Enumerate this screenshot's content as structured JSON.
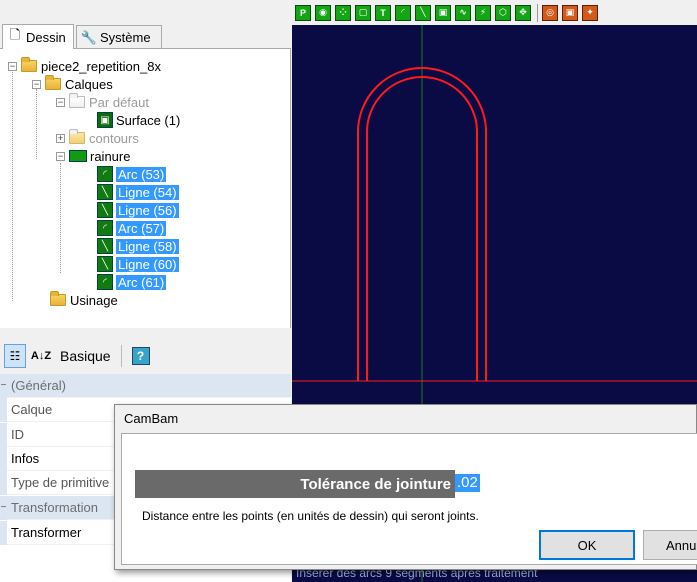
{
  "tabs": [
    {
      "label": "Dessin",
      "icon": "document-icon"
    },
    {
      "label": "Système",
      "icon": "wrench-icon"
    }
  ],
  "tree": {
    "root": "piece2_repetition_8x",
    "calques": "Calques",
    "par_defaut": "Par défaut",
    "surface": "Surface (1)",
    "contours": "contours",
    "rainure": "rainure",
    "items": [
      "Arc (53)",
      "Ligne (54)",
      "Ligne (56)",
      "Arc (57)",
      "Ligne (58)",
      "Ligne (60)",
      "Arc (61)"
    ],
    "usinage": "Usinage"
  },
  "props_toolbar": {
    "basique": "Basique",
    "help": "?"
  },
  "props": {
    "general": "(Général)",
    "calque": "Calque",
    "id": "ID",
    "infos": "Infos",
    "type": "Type de primitive",
    "transformation": "Transformation",
    "transformer": "Transformer"
  },
  "canvas": {
    "status_hint": "Insérer des arcs 9 segments après traitement",
    "colors": {
      "background": "#0a0a45",
      "shape": "#ff1a1a",
      "axis_v": "#1f7a1f"
    }
  },
  "dialog": {
    "title": "CamBam",
    "label": "Tolérance de jointure",
    "value": ".02",
    "description": "Distance entre les points (en unités de dessin) qui seront joints.",
    "ok": "OK",
    "cancel": "Annuler"
  }
}
